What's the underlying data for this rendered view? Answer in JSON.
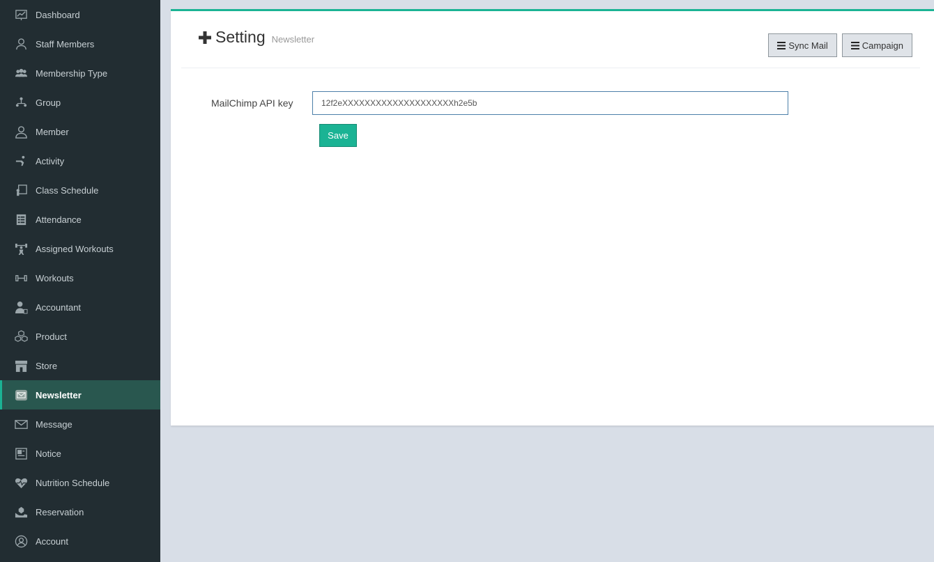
{
  "sidebar": {
    "items": [
      {
        "label": "Dashboard",
        "icon": "dashboard-icon"
      },
      {
        "label": "Staff Members",
        "icon": "staff-icon"
      },
      {
        "label": "Membership Type",
        "icon": "membership-icon"
      },
      {
        "label": "Group",
        "icon": "group-icon"
      },
      {
        "label": "Member",
        "icon": "member-icon"
      },
      {
        "label": "Activity",
        "icon": "activity-icon"
      },
      {
        "label": "Class Schedule",
        "icon": "class-schedule-icon"
      },
      {
        "label": "Attendance",
        "icon": "attendance-icon"
      },
      {
        "label": "Assigned Workouts",
        "icon": "assigned-workouts-icon"
      },
      {
        "label": "Workouts",
        "icon": "workouts-icon"
      },
      {
        "label": "Accountant",
        "icon": "accountant-icon"
      },
      {
        "label": "Product",
        "icon": "product-icon"
      },
      {
        "label": "Store",
        "icon": "store-icon"
      },
      {
        "label": "Newsletter",
        "icon": "newsletter-icon"
      },
      {
        "label": "Message",
        "icon": "message-icon"
      },
      {
        "label": "Notice",
        "icon": "notice-icon"
      },
      {
        "label": "Nutrition Schedule",
        "icon": "nutrition-icon"
      },
      {
        "label": "Reservation",
        "icon": "reservation-icon"
      },
      {
        "label": "Account",
        "icon": "account-icon"
      }
    ],
    "active_item": "Newsletter"
  },
  "header": {
    "title": "Setting",
    "subtitle": "Newsletter",
    "sync_mail_label": "Sync Mail",
    "campaign_label": "Campaign"
  },
  "form": {
    "api_key_label": "MailChimp API key",
    "api_key_value": "12f2eXXXXXXXXXXXXXXXXXXXXh2e5b",
    "save_label": "Save"
  },
  "colors": {
    "sidebar_bg": "#222d32",
    "accent": "#1bb394",
    "active_item_bg": "#29574f"
  }
}
